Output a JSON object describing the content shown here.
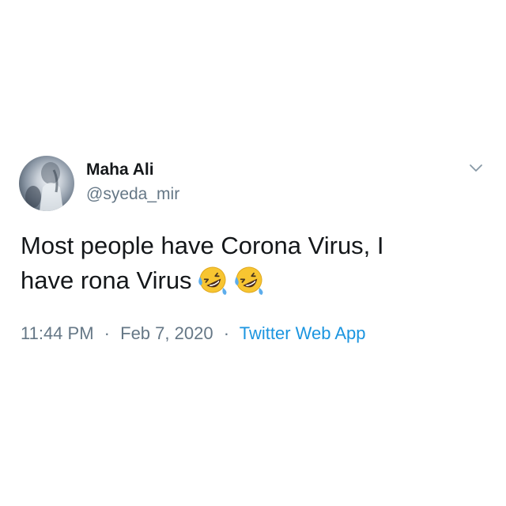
{
  "tweet": {
    "display_name": "Maha Ali",
    "handle": "@syeda_mir",
    "text_line_1": "Most people have Corona Virus, I",
    "text_line_2": "have rona Virus",
    "emojis": [
      "rolling-on-floor-laughing-icon",
      "rolling-on-floor-laughing-icon"
    ],
    "time": "11:44 PM",
    "date": "Feb 7, 2020",
    "separator": "·",
    "source": "Twitter Web App"
  },
  "icons": {
    "menu": "chevron-down-icon",
    "avatar": "avatar"
  },
  "colors": {
    "text": "#14171a",
    "secondary": "#657786",
    "link": "#1b95e0",
    "emoji_face": "#f7c531"
  }
}
